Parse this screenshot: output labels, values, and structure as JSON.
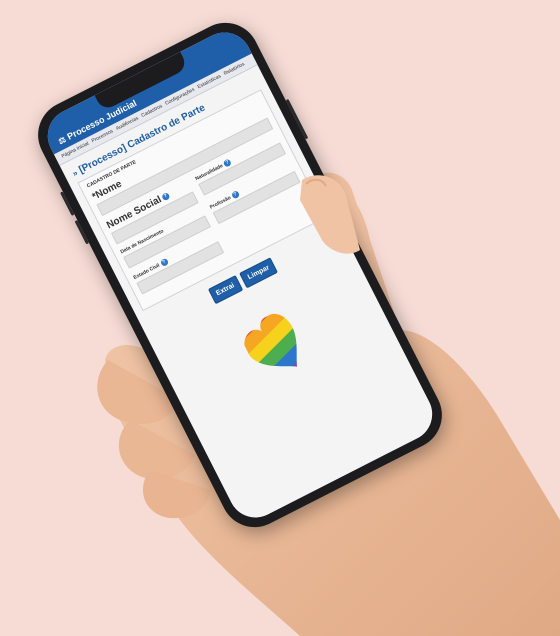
{
  "app": {
    "title": "Processo Judicial"
  },
  "menu": [
    "Página Inicial",
    "Processos",
    "Audiências",
    "Cadastros",
    "Configurações",
    "Estatísticas",
    "Relatórios"
  ],
  "page": {
    "title": "[Processo] Cadastro de Parte"
  },
  "form": {
    "legend": "CADASTRO DE PARTE",
    "nome_label": "*Nome",
    "nome_social_label": "Nome Social",
    "naturalidade_label": "Naturalidade",
    "data_nascimento_label": "Data de Nascimento",
    "profissao_label": "Profissão",
    "estado_civil_label": "Estado Civil"
  },
  "buttons": {
    "extrair": "Extrai",
    "limpar": "Limpar"
  },
  "colors": {
    "header": "#1f5ea8",
    "background": "#f7dcd5",
    "heart_stripes": [
      "#e94b3c",
      "#f5a623",
      "#f7d21c",
      "#4cae4f",
      "#2d76c9",
      "#7b4ca0"
    ]
  }
}
